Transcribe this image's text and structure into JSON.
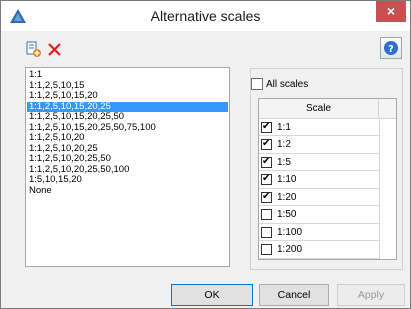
{
  "window": {
    "title": "Alternative scales",
    "close_symbol": "×"
  },
  "toolbar": {
    "add_icon": "add-scale-icon",
    "delete_icon": "delete-icon",
    "help_icon": "help-icon"
  },
  "scale_list": {
    "items": [
      "1:1",
      "1:1,2,5,10,15",
      "1:1,2,5,10,15,20",
      "1:1,2,5,10,15,20,25",
      "1:1,2,5,10,15,20,25,50",
      "1:1,2,5,10,15,20,25,50,75,100",
      "1:1,2,5,10,20",
      "1:1,2,5,10,20,25",
      "1:1,2,5,10,20,25,50",
      "1:1,2,5,10,20,25,50,100",
      "1:5,10,15,20",
      "None"
    ],
    "selected_index": 3
  },
  "all_scales": {
    "label": "All scales",
    "checked": false
  },
  "scale_table": {
    "header": "Scale",
    "rows": [
      {
        "value": "1:1",
        "checked": true
      },
      {
        "value": "1:2",
        "checked": true
      },
      {
        "value": "1:5",
        "checked": true
      },
      {
        "value": "1:10",
        "checked": true
      },
      {
        "value": "1:20",
        "checked": true
      },
      {
        "value": "1:50",
        "checked": false
      },
      {
        "value": "1:100",
        "checked": false
      },
      {
        "value": "1:200",
        "checked": false
      }
    ]
  },
  "buttons": {
    "ok": "OK",
    "cancel": "Cancel",
    "apply": "Apply"
  }
}
